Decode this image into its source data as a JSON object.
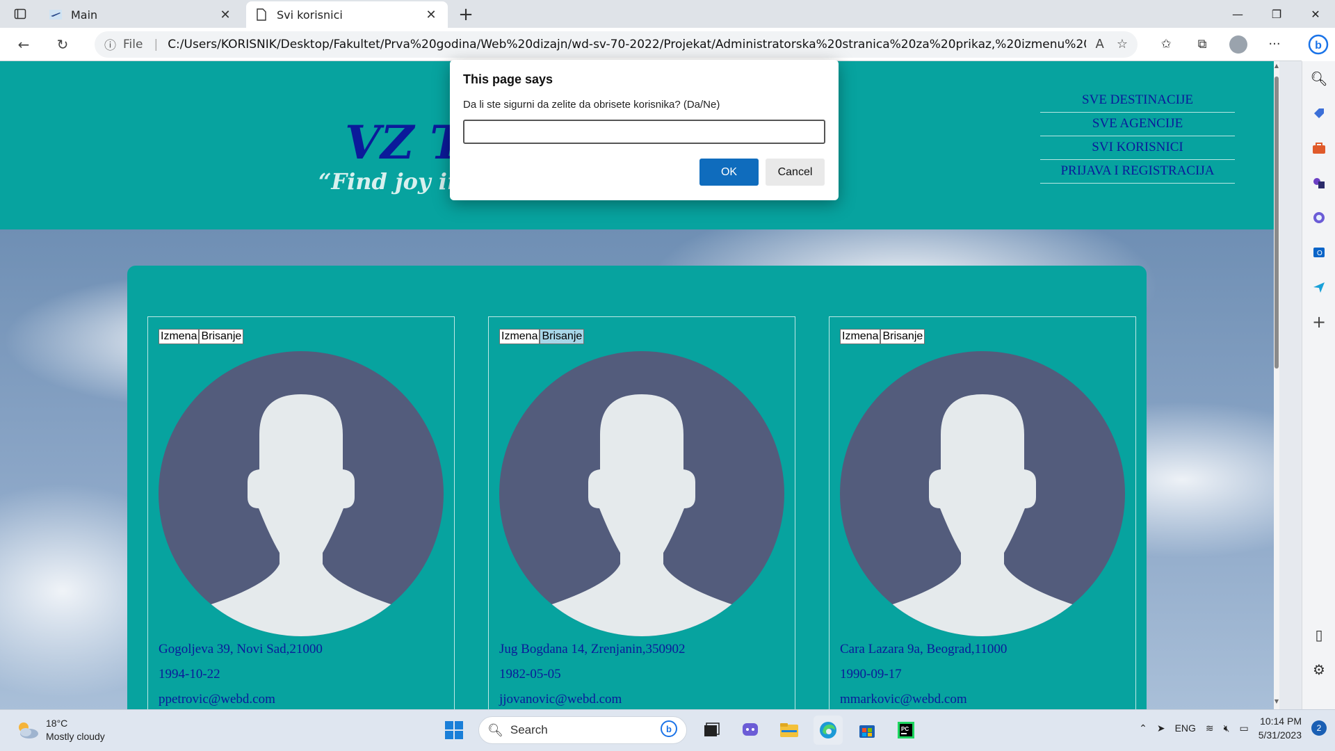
{
  "browser": {
    "tabs": [
      {
        "title": "Main",
        "active": false
      },
      {
        "title": "Svi korisnici",
        "active": true
      }
    ],
    "address": {
      "scheme_label": "File",
      "url": "C:/Users/KORISNIK/Desktop/Fakultet/Prva%20godina/Web%20dizajn/wd-sv-70-2022/Projekat/Administratorska%20stranica%20za%20prikaz,%20izmenu%20i%20bris..."
    }
  },
  "site": {
    "brand": "VZ T",
    "slogan": "“Find joy in",
    "nav": [
      "SVE DESTINACIJE",
      "SVE AGENCIJE",
      "SVI KORISNICI",
      "PRIJAVA I REGISTRACIJA"
    ]
  },
  "users": [
    {
      "edit_label": "Izmena",
      "delete_label": "Brisanje",
      "address": "Gogoljeva 39, Novi Sad,21000",
      "birthdate": "1994-10-22",
      "email": "ppetrovic@webd.com"
    },
    {
      "edit_label": "Izmena",
      "delete_label": "Brisanje",
      "address": "Jug Bogdana 14, Zrenjanin,350902",
      "birthdate": "1982-05-05",
      "email": "jjovanovic@webd.com"
    },
    {
      "edit_label": "Izmena",
      "delete_label": "Brisanje",
      "address": "Cara Lazara 9a, Beograd,11000",
      "birthdate": "1990-09-17",
      "email": "mmarkovic@webd.com"
    }
  ],
  "dialog": {
    "title": "This page says",
    "message": "Da li ste sigurni da zelite da obrisete korisnika? (Da/Ne)",
    "input_value": "",
    "ok_label": "OK",
    "cancel_label": "Cancel"
  },
  "taskbar": {
    "temperature": "18°C",
    "weather": "Mostly cloudy",
    "search_placeholder": "Search",
    "language": "ENG",
    "time": "10:14 PM",
    "date": "5/31/2023",
    "notification_count": "2"
  },
  "colors": {
    "site_teal": "#07a39f",
    "site_blue_text": "#0b1a9a",
    "avatar_bg": "#535c7c",
    "avatar_fg": "#e5eaec",
    "ok_button": "#0f6cbd"
  }
}
